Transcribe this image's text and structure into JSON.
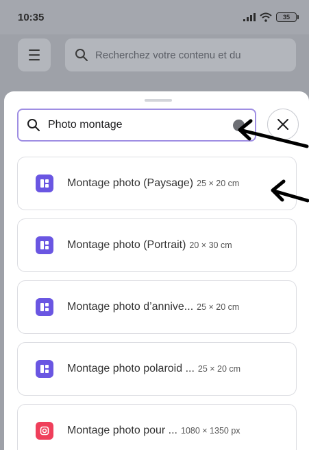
{
  "status_bar": {
    "time": "10:35",
    "battery": "35"
  },
  "top_bar": {
    "search_placeholder": "Recherchez votre contenu et du"
  },
  "search": {
    "value": "Photo montage"
  },
  "results": [
    {
      "title": "Montage photo (Paysage)",
      "size": "25 × 20 cm",
      "icon": "photo-collage-icon",
      "color": "#6a56e2"
    },
    {
      "title": "Montage photo (Portrait)",
      "size": "20 × 30 cm",
      "icon": "photo-collage-icon",
      "color": "#6a56e2"
    },
    {
      "title": "Montage photo d’annive...",
      "size": "25 × 20 cm",
      "icon": "photo-collage-icon",
      "color": "#6a56e2"
    },
    {
      "title": "Montage photo polaroid ...",
      "size": "25 × 20 cm",
      "icon": "photo-collage-icon",
      "color": "#6a56e2"
    },
    {
      "title": "Montage photo pour ...",
      "size": "1080 × 1350 px",
      "icon": "instagram-icon",
      "color": "#ef3f5b"
    }
  ],
  "colors": {
    "accent": "#9f8ee3",
    "overlay": "#9ea1a8",
    "arrow": "#000000"
  }
}
